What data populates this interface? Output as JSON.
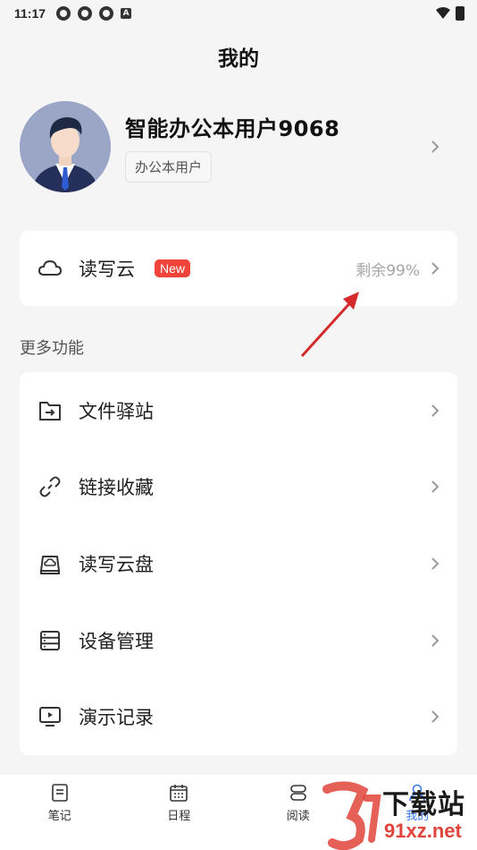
{
  "status_bar": {
    "time": "11:17",
    "a_label": "A"
  },
  "page_title": "我的",
  "profile": {
    "name": "智能办公本用户9068",
    "badge": "办公本用户"
  },
  "cloud": {
    "label": "读写云",
    "badge": "New",
    "remaining": "剩余99%"
  },
  "section_title": "更多功能",
  "features": [
    {
      "label": "文件驿站",
      "icon": "folder-arrow-icon"
    },
    {
      "label": "链接收藏",
      "icon": "link-icon"
    },
    {
      "label": "读写云盘",
      "icon": "cloud-drive-icon"
    },
    {
      "label": "设备管理",
      "icon": "device-list-icon"
    },
    {
      "label": "演示记录",
      "icon": "presentation-icon"
    }
  ],
  "tabs": [
    {
      "label": "笔记",
      "icon": "note-icon"
    },
    {
      "label": "日程",
      "icon": "calendar-icon"
    },
    {
      "label": "阅读",
      "icon": "book-icon"
    },
    {
      "label": "我的",
      "icon": "user-icon"
    }
  ],
  "watermark": {
    "text": "下载站",
    "url": "91xz.net"
  },
  "colors": {
    "accent": "#3a78f2",
    "badge_red": "#f0443a",
    "annotation": "#d42a2a"
  }
}
